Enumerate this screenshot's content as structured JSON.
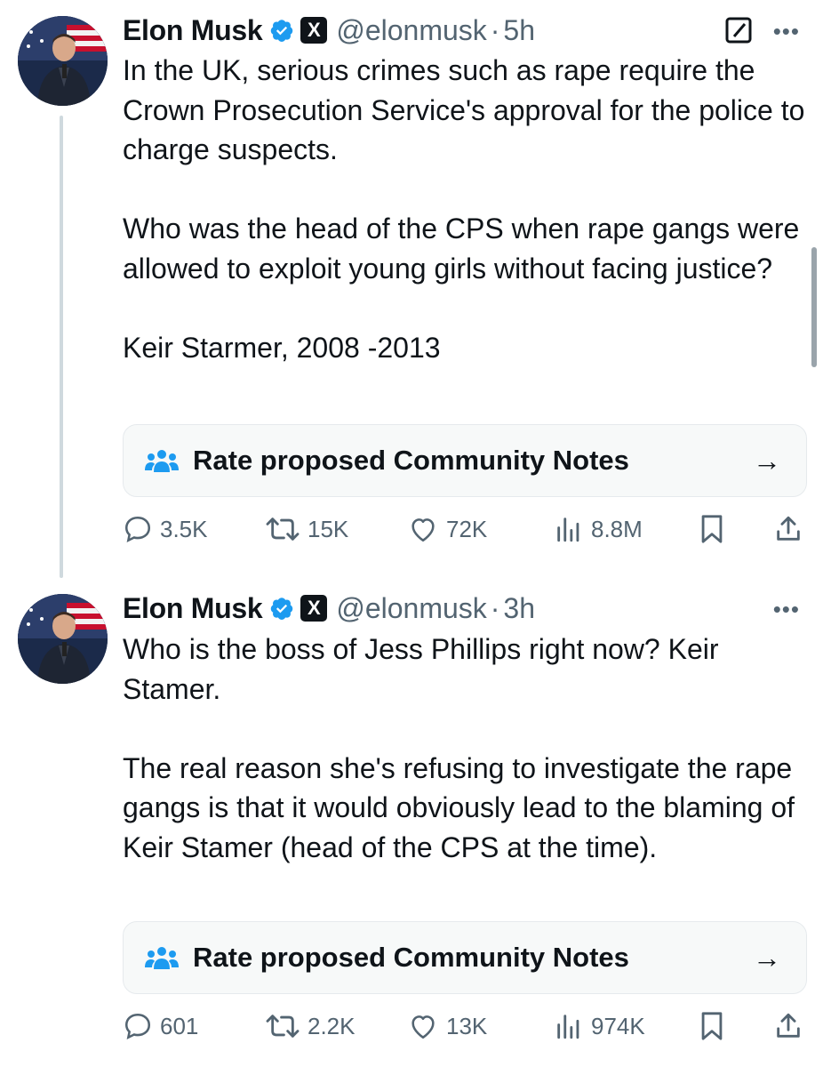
{
  "tweets": [
    {
      "author_name": "Elon Musk",
      "handle": "@elonmusk",
      "separator": "·",
      "time": "5h",
      "more": "•••",
      "paragraphs": [
        "In the UK, serious crimes such as rape require the Crown Prosecution Service's approval for the police to charge suspects.",
        "Who was the head of the CPS when rape gangs were allowed to exploit young girls without facing justice?",
        "Keir Starmer, 2008 -2013"
      ],
      "community_notes_label": "Rate proposed Community Notes",
      "arrow": "→",
      "stats": {
        "replies": "3.5K",
        "reposts": "15K",
        "likes": "72K",
        "views": "8.8M"
      }
    },
    {
      "author_name": "Elon Musk",
      "handle": "@elonmusk",
      "separator": "·",
      "time": "3h",
      "more": "•••",
      "paragraphs": [
        "Who is the boss of Jess Phillips right now? Keir Stamer.",
        "The real reason she's refusing to investigate the rape gangs is that it would obviously lead to the blaming of Keir Stamer (head of the CPS at the time)."
      ],
      "community_notes_label": "Rate proposed Community Notes",
      "arrow": "→",
      "stats": {
        "replies": "601",
        "reposts": "2.2K",
        "likes": "13K",
        "views": "974K"
      }
    }
  ],
  "icons": {
    "verified": "verified-badge-icon",
    "x_logo": "X",
    "community_notes": "people-group-icon",
    "reply": "speech-bubble-icon",
    "repost": "repost-arrows-icon",
    "like": "heart-icon",
    "views": "bar-chart-icon",
    "bookmark": "bookmark-icon",
    "share": "share-icon",
    "edit": "edit-square-icon"
  },
  "colors": {
    "verified": "#1d9bf0",
    "text": "#0f1419",
    "muted": "#536471",
    "community_notes": "#1d9bf0"
  }
}
